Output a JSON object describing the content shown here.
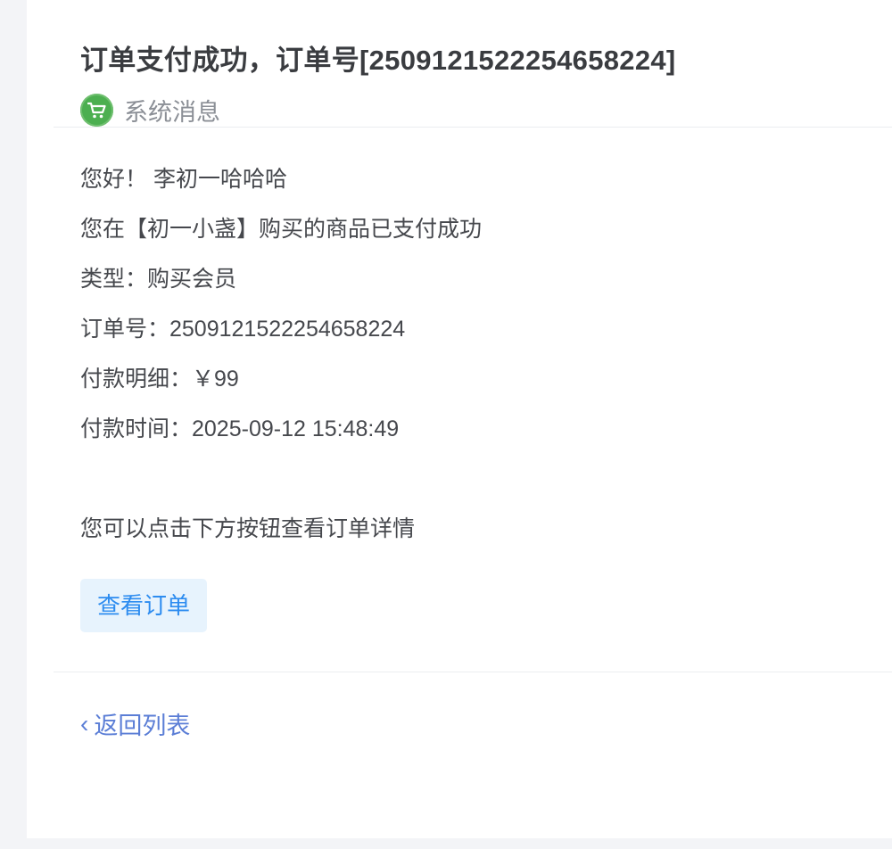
{
  "message": {
    "title": "订单支付成功，订单号[2509121522254658224]",
    "sender": {
      "icon": "shopping-cart-icon",
      "icon_color": "#4caf50",
      "name": "系统消息"
    }
  },
  "body": {
    "greeting": "您好！ 李初一哈哈哈",
    "intro": "您在【初一小盏】购买的商品已支付成功",
    "type_line": "类型：购买会员",
    "order_line": "订单号：2509121522254658224",
    "payment_line": "付款明细：￥99",
    "time_line": "付款时间：2025-09-12 15:48:49",
    "hint": "您可以点击下方按钮查看订单详情",
    "view_button": "查看订单"
  },
  "footer": {
    "back_chevron": "‹",
    "back_label": "返回列表"
  },
  "colors": {
    "accent": "#2d8cf0",
    "link": "#5b7ed6",
    "sender_green": "#4caf50"
  }
}
